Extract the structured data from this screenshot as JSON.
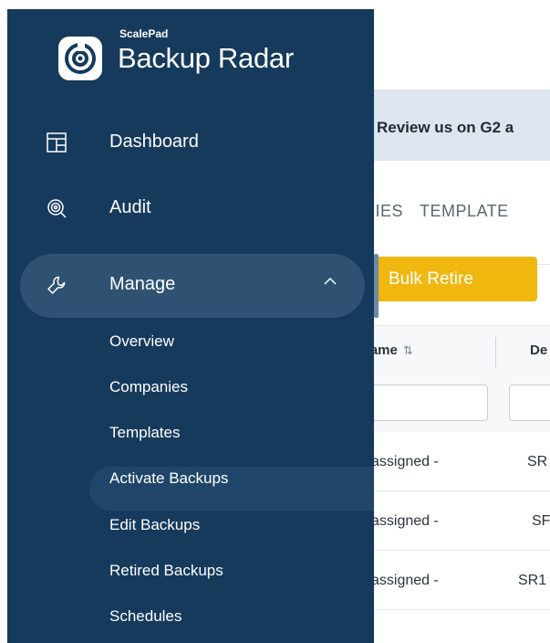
{
  "brand": {
    "company": "ScalePad",
    "product": "Backup Radar"
  },
  "nav": {
    "items": [
      {
        "label": "Dashboard",
        "icon": "dashboard-icon"
      },
      {
        "label": "Audit",
        "icon": "audit-icon"
      },
      {
        "label": "Manage",
        "icon": "wrench-icon",
        "expanded": true
      }
    ],
    "manage_sub": [
      {
        "label": "Overview"
      },
      {
        "label": "Companies"
      },
      {
        "label": "Templates"
      },
      {
        "label": "Activate Backups",
        "active": true
      },
      {
        "label": "Edit Backups"
      },
      {
        "label": "Retired Backups"
      },
      {
        "label": "Schedules"
      }
    ]
  },
  "banner": {
    "text": "Review us on G2 a"
  },
  "tabs": [
    {
      "label": "NIES"
    },
    {
      "label": "TEMPLATE"
    }
  ],
  "toolbar": {
    "bulk_retire": "Bulk Retire"
  },
  "table": {
    "headers": [
      {
        "label": "Name",
        "sortable": true
      },
      {
        "label": "De"
      }
    ],
    "rows": [
      {
        "name": "assigned -",
        "desc": "SR"
      },
      {
        "name": "assigned -",
        "desc": "SF"
      },
      {
        "name": "assigned -",
        "desc": "SR1"
      }
    ]
  },
  "colors": {
    "sidebar": "#153a5c",
    "accent": "#f0b70f",
    "banner": "#dde6ee"
  }
}
